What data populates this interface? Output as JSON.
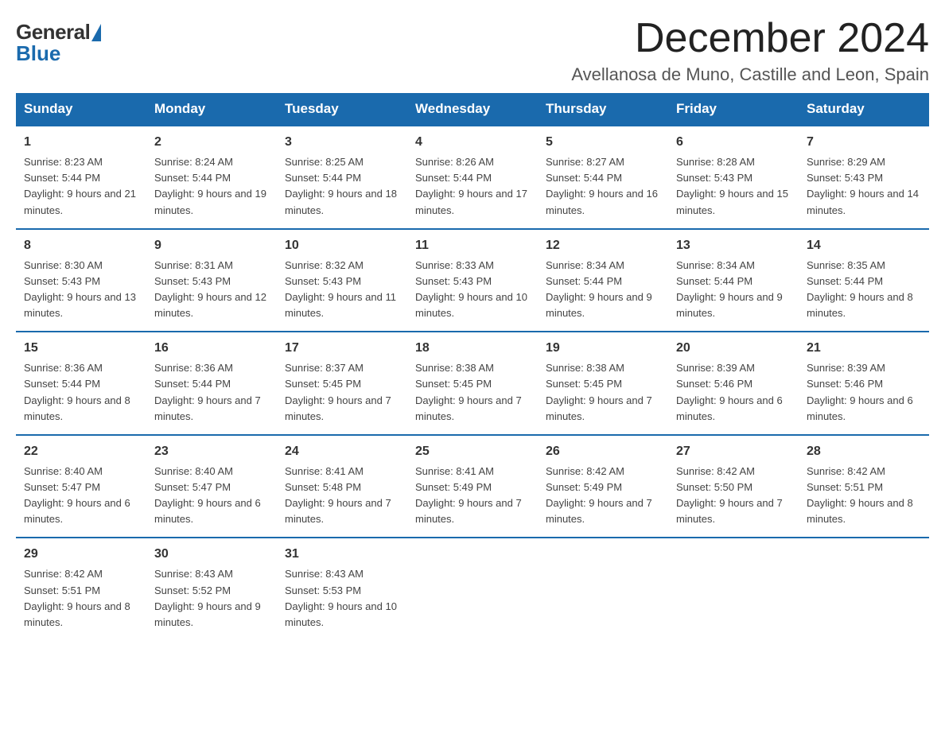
{
  "logo": {
    "general": "General",
    "blue": "Blue"
  },
  "title": "December 2024",
  "location": "Avellanosa de Muno, Castille and Leon, Spain",
  "headers": [
    "Sunday",
    "Monday",
    "Tuesday",
    "Wednesday",
    "Thursday",
    "Friday",
    "Saturday"
  ],
  "weeks": [
    [
      {
        "day": "1",
        "sunrise": "Sunrise: 8:23 AM",
        "sunset": "Sunset: 5:44 PM",
        "daylight": "Daylight: 9 hours and 21 minutes."
      },
      {
        "day": "2",
        "sunrise": "Sunrise: 8:24 AM",
        "sunset": "Sunset: 5:44 PM",
        "daylight": "Daylight: 9 hours and 19 minutes."
      },
      {
        "day": "3",
        "sunrise": "Sunrise: 8:25 AM",
        "sunset": "Sunset: 5:44 PM",
        "daylight": "Daylight: 9 hours and 18 minutes."
      },
      {
        "day": "4",
        "sunrise": "Sunrise: 8:26 AM",
        "sunset": "Sunset: 5:44 PM",
        "daylight": "Daylight: 9 hours and 17 minutes."
      },
      {
        "day": "5",
        "sunrise": "Sunrise: 8:27 AM",
        "sunset": "Sunset: 5:44 PM",
        "daylight": "Daylight: 9 hours and 16 minutes."
      },
      {
        "day": "6",
        "sunrise": "Sunrise: 8:28 AM",
        "sunset": "Sunset: 5:43 PM",
        "daylight": "Daylight: 9 hours and 15 minutes."
      },
      {
        "day": "7",
        "sunrise": "Sunrise: 8:29 AM",
        "sunset": "Sunset: 5:43 PM",
        "daylight": "Daylight: 9 hours and 14 minutes."
      }
    ],
    [
      {
        "day": "8",
        "sunrise": "Sunrise: 8:30 AM",
        "sunset": "Sunset: 5:43 PM",
        "daylight": "Daylight: 9 hours and 13 minutes."
      },
      {
        "day": "9",
        "sunrise": "Sunrise: 8:31 AM",
        "sunset": "Sunset: 5:43 PM",
        "daylight": "Daylight: 9 hours and 12 minutes."
      },
      {
        "day": "10",
        "sunrise": "Sunrise: 8:32 AM",
        "sunset": "Sunset: 5:43 PM",
        "daylight": "Daylight: 9 hours and 11 minutes."
      },
      {
        "day": "11",
        "sunrise": "Sunrise: 8:33 AM",
        "sunset": "Sunset: 5:43 PM",
        "daylight": "Daylight: 9 hours and 10 minutes."
      },
      {
        "day": "12",
        "sunrise": "Sunrise: 8:34 AM",
        "sunset": "Sunset: 5:44 PM",
        "daylight": "Daylight: 9 hours and 9 minutes."
      },
      {
        "day": "13",
        "sunrise": "Sunrise: 8:34 AM",
        "sunset": "Sunset: 5:44 PM",
        "daylight": "Daylight: 9 hours and 9 minutes."
      },
      {
        "day": "14",
        "sunrise": "Sunrise: 8:35 AM",
        "sunset": "Sunset: 5:44 PM",
        "daylight": "Daylight: 9 hours and 8 minutes."
      }
    ],
    [
      {
        "day": "15",
        "sunrise": "Sunrise: 8:36 AM",
        "sunset": "Sunset: 5:44 PM",
        "daylight": "Daylight: 9 hours and 8 minutes."
      },
      {
        "day": "16",
        "sunrise": "Sunrise: 8:36 AM",
        "sunset": "Sunset: 5:44 PM",
        "daylight": "Daylight: 9 hours and 7 minutes."
      },
      {
        "day": "17",
        "sunrise": "Sunrise: 8:37 AM",
        "sunset": "Sunset: 5:45 PM",
        "daylight": "Daylight: 9 hours and 7 minutes."
      },
      {
        "day": "18",
        "sunrise": "Sunrise: 8:38 AM",
        "sunset": "Sunset: 5:45 PM",
        "daylight": "Daylight: 9 hours and 7 minutes."
      },
      {
        "day": "19",
        "sunrise": "Sunrise: 8:38 AM",
        "sunset": "Sunset: 5:45 PM",
        "daylight": "Daylight: 9 hours and 7 minutes."
      },
      {
        "day": "20",
        "sunrise": "Sunrise: 8:39 AM",
        "sunset": "Sunset: 5:46 PM",
        "daylight": "Daylight: 9 hours and 6 minutes."
      },
      {
        "day": "21",
        "sunrise": "Sunrise: 8:39 AM",
        "sunset": "Sunset: 5:46 PM",
        "daylight": "Daylight: 9 hours and 6 minutes."
      }
    ],
    [
      {
        "day": "22",
        "sunrise": "Sunrise: 8:40 AM",
        "sunset": "Sunset: 5:47 PM",
        "daylight": "Daylight: 9 hours and 6 minutes."
      },
      {
        "day": "23",
        "sunrise": "Sunrise: 8:40 AM",
        "sunset": "Sunset: 5:47 PM",
        "daylight": "Daylight: 9 hours and 6 minutes."
      },
      {
        "day": "24",
        "sunrise": "Sunrise: 8:41 AM",
        "sunset": "Sunset: 5:48 PM",
        "daylight": "Daylight: 9 hours and 7 minutes."
      },
      {
        "day": "25",
        "sunrise": "Sunrise: 8:41 AM",
        "sunset": "Sunset: 5:49 PM",
        "daylight": "Daylight: 9 hours and 7 minutes."
      },
      {
        "day": "26",
        "sunrise": "Sunrise: 8:42 AM",
        "sunset": "Sunset: 5:49 PM",
        "daylight": "Daylight: 9 hours and 7 minutes."
      },
      {
        "day": "27",
        "sunrise": "Sunrise: 8:42 AM",
        "sunset": "Sunset: 5:50 PM",
        "daylight": "Daylight: 9 hours and 7 minutes."
      },
      {
        "day": "28",
        "sunrise": "Sunrise: 8:42 AM",
        "sunset": "Sunset: 5:51 PM",
        "daylight": "Daylight: 9 hours and 8 minutes."
      }
    ],
    [
      {
        "day": "29",
        "sunrise": "Sunrise: 8:42 AM",
        "sunset": "Sunset: 5:51 PM",
        "daylight": "Daylight: 9 hours and 8 minutes."
      },
      {
        "day": "30",
        "sunrise": "Sunrise: 8:43 AM",
        "sunset": "Sunset: 5:52 PM",
        "daylight": "Daylight: 9 hours and 9 minutes."
      },
      {
        "day": "31",
        "sunrise": "Sunrise: 8:43 AM",
        "sunset": "Sunset: 5:53 PM",
        "daylight": "Daylight: 9 hours and 10 minutes."
      },
      null,
      null,
      null,
      null
    ]
  ]
}
